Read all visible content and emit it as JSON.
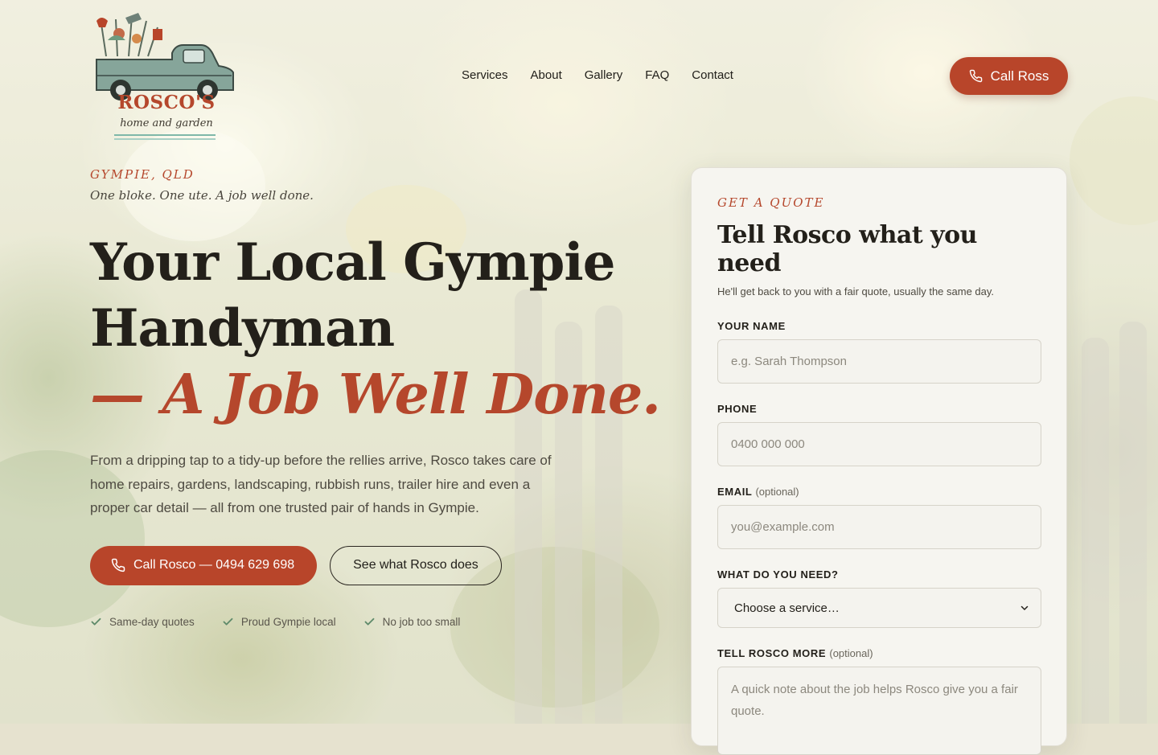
{
  "brand": {
    "name": "ROSCO'S",
    "subtitle": "home and garden",
    "colors": {
      "accent": "#b8452a",
      "ink": "#23201a",
      "truck": "#7f9d93",
      "rule": "#7fb8a9"
    }
  },
  "nav": {
    "items": [
      "Services",
      "About",
      "Gallery",
      "FAQ",
      "Contact"
    ],
    "call_label": "Call Ross",
    "call_icon": "phone-icon"
  },
  "hero": {
    "location": "GYMPIE, QLD",
    "tagline": "One bloke. One ute. A job well done.",
    "title_line1": "Your Local Gympie",
    "title_line2": "Handyman",
    "title_accent": "— A Job Well Done.",
    "lede": "From a dripping tap to a tidy-up before the rellies arrive, Rosco takes care of home repairs, gardens, landscaping, rubbish runs, trailer hire and even a proper car detail — all from one trusted pair of hands in Gympie.",
    "primary_cta": "Call Rosco — 0494 629 698",
    "secondary_cta": "See what Rosco does",
    "checks": [
      "Same-day quotes",
      "Proud Gympie local",
      "No job too small"
    ]
  },
  "quote_form": {
    "eyebrow": "GET A QUOTE",
    "title": "Tell Rosco what you need",
    "subtitle": "He'll get back to you with a fair quote, usually the same day.",
    "name_label": "YOUR NAME",
    "name_placeholder": "e.g. Sarah Thompson",
    "phone_label": "PHONE",
    "phone_placeholder": "0400 000 000",
    "email_label": "EMAIL",
    "email_optional": "(optional)",
    "email_placeholder": "you@example.com",
    "service_label": "WHAT DO YOU NEED?",
    "service_selected": "Choose a service…",
    "more_label": "TELL ROSCO MORE",
    "more_optional": "(optional)",
    "more_placeholder": "A quick note about the job helps Rosco give you a fair quote."
  }
}
